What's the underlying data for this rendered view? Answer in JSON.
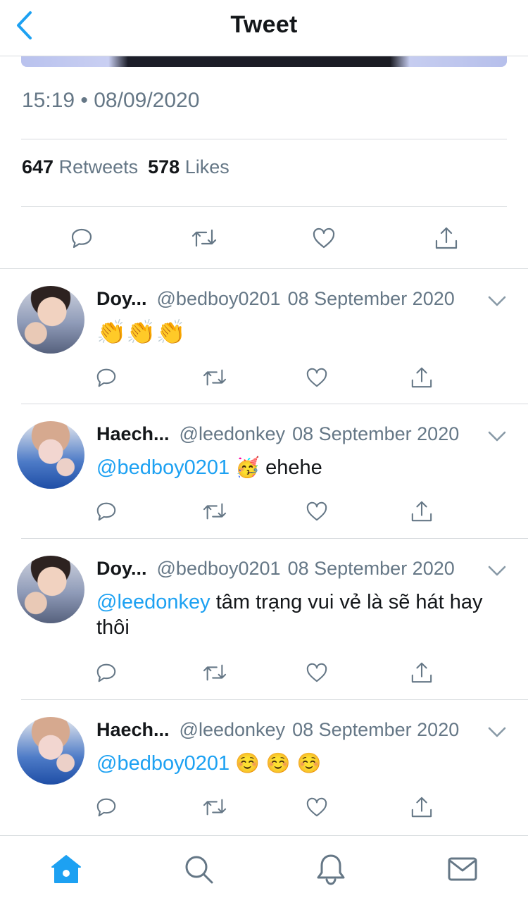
{
  "nav": {
    "title": "Tweet",
    "back_icon": "chevron-left-icon"
  },
  "tweet": {
    "timestamp": "15:19 • 08/09/2020",
    "retweet_count": "647",
    "retweet_label": "Retweets",
    "like_count": "578",
    "like_label": "Likes"
  },
  "replies": [
    {
      "name": "Doy...",
      "handle": "@bedboy0201",
      "date": "08 September 2020",
      "mention": "",
      "text": "👏👏👏",
      "text_is_emoji": true
    },
    {
      "name": "Haech...",
      "handle": "@leedonkey",
      "date": "08 September 2020",
      "mention": "@bedboy0201",
      "emoji": "🥳",
      "text": "ehehe"
    },
    {
      "name": "Doy...",
      "handle": "@bedboy0201",
      "date": "08 September 2020",
      "mention": "@leedonkey",
      "text": "tâm trạng vui vẻ là sẽ hát hay thôi"
    },
    {
      "name": "Haech...",
      "handle": "@leedonkey",
      "date": "08 September 2020",
      "mention": "@bedboy0201",
      "emoji": "☺️ ☺️ ☺️"
    }
  ],
  "tabs": [
    "home-icon",
    "search-icon",
    "notifications-icon",
    "messages-icon"
  ],
  "colors": {
    "accent": "#1da1f2",
    "secondary_text": "#657786",
    "divider": "#d6dadd"
  }
}
